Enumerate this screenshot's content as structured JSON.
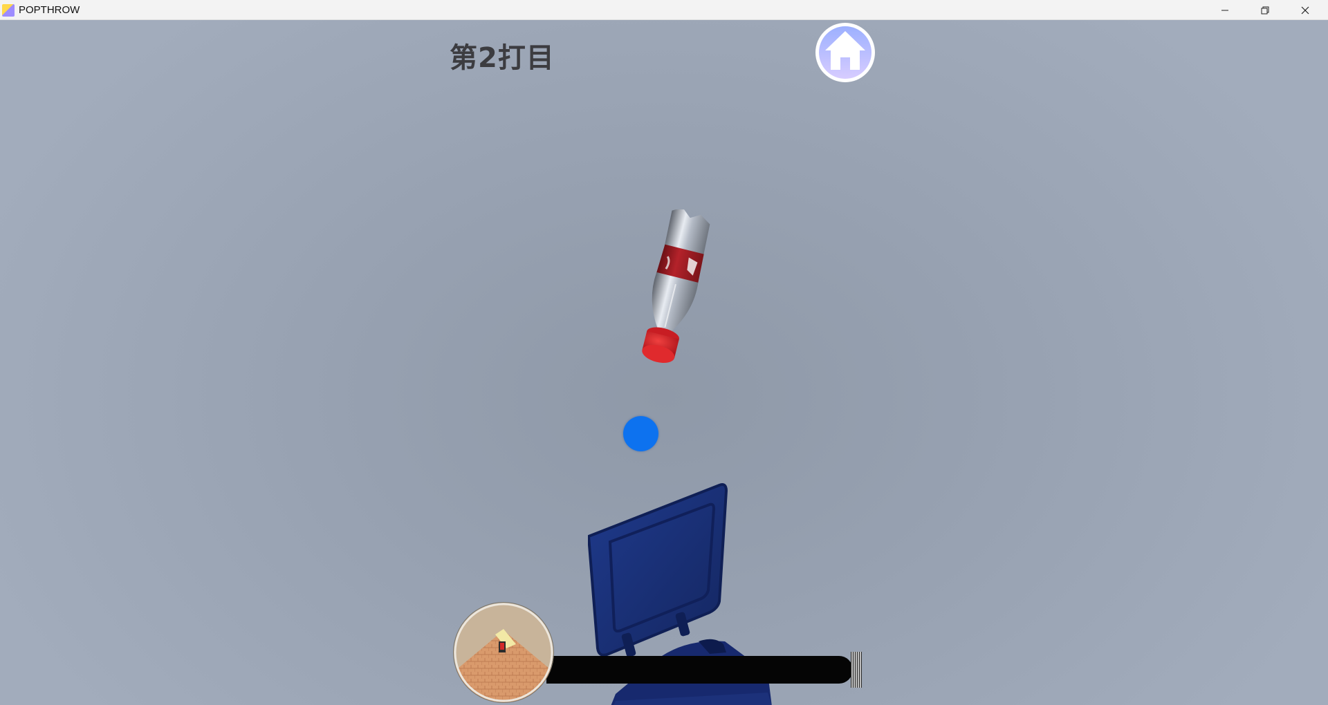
{
  "window": {
    "title": "POPTHROW",
    "controls": {
      "minimize_icon": "minimize-icon",
      "maximize_icon": "restore-icon",
      "close_icon": "close-icon"
    }
  },
  "hud": {
    "shot_label": "第2打目",
    "home_icon": "house-icon",
    "power_gauge": {
      "level": 0
    }
  },
  "scene": {
    "objects": [
      "soda-bottle",
      "aim-dot",
      "trash-bin",
      "minimap"
    ],
    "colors": {
      "sky": "#97a1b1",
      "aim_dot": "#0d72ef",
      "bin": "#1a2d6e",
      "bottle_label": "#a51c23",
      "bottle_cap": "#d81f24",
      "power_track": "#050505"
    }
  }
}
